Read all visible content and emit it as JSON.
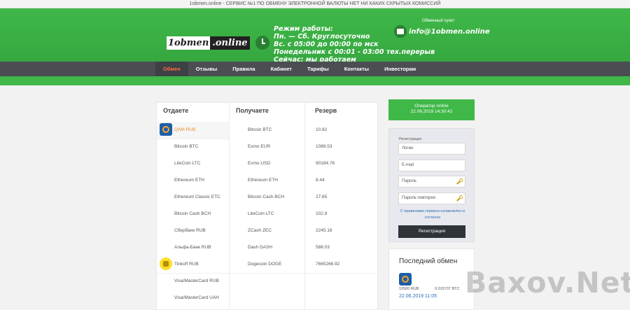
{
  "topbar": {
    "text": "1obmen.online - СЕРВИС №1 ПО ОБМЕНУ ЭЛЕКТРОННОЙ ВАЛЮТЫ НЕТ НИ КАКИХ СКРЫТЫХ КОМИССИЙ"
  },
  "header": {
    "logo_part1": "1obmen",
    "logo_part2": ".online",
    "hours": [
      "Режим работы:",
      "Пн. — Сб.  Круглосуточно",
      "Вс. с 05:00 до 00:00 по мск",
      "Понедельник с 00:01 - 03:00 тех.перерыв",
      "Сейчас: мы работаем"
    ],
    "exchanger_label": "Обменный пункт",
    "email": "info@1obmen.online"
  },
  "nav": {
    "items": [
      {
        "label": "Обмен",
        "active": true
      },
      {
        "label": "Отзывы",
        "active": false
      },
      {
        "label": "Правила",
        "active": false
      },
      {
        "label": "Кабинет",
        "active": false
      },
      {
        "label": "Тарифы",
        "active": false
      },
      {
        "label": "Контакты",
        "active": false
      },
      {
        "label": "Инвесторам",
        "active": false
      }
    ]
  },
  "table": {
    "headers": {
      "give": "Отдаете",
      "receive": "Получаете",
      "reserve": "Резерв"
    },
    "give": [
      {
        "label": "QIWI RUB",
        "icon": "qiwi-icon",
        "selected": true
      },
      {
        "label": "Bitcoin BTC"
      },
      {
        "label": "LiteCoin LTC"
      },
      {
        "label": "Ethereum ETH"
      },
      {
        "label": "Ethereum Classic ETC"
      },
      {
        "label": "Bitcoin Cash BCH"
      },
      {
        "label": "Сбербанк RUB"
      },
      {
        "label": "Альфа-Банк RUB"
      },
      {
        "label": "Tinkoff RUB",
        "icon": "tinkoff-icon"
      },
      {
        "label": "Visa/MasterCard RUB"
      },
      {
        "label": "Visa/MasterCard UAH"
      }
    ],
    "receive": [
      {
        "label": "Bitcoin BTC",
        "reserve": "10.82"
      },
      {
        "label": "Exmo EUR",
        "reserve": "1089.53"
      },
      {
        "label": "Exmo USD",
        "reserve": "90184.76"
      },
      {
        "label": "Ethereum ETH",
        "reserve": "8.44"
      },
      {
        "label": "Bitcoin Cash BCH",
        "reserve": "27.65"
      },
      {
        "label": "LiteCoin LTC",
        "reserve": "102.9"
      },
      {
        "label": "ZCash ZEC",
        "reserve": "2245.16"
      },
      {
        "label": "Dash DASH",
        "reserve": "588.03"
      },
      {
        "label": "Dogecoin DOGE",
        "reserve": "7665266.92"
      }
    ]
  },
  "operator": {
    "status": "Оператор online",
    "datetime": "22.06.2019 14:30:42"
  },
  "registration": {
    "title": "Регистрация",
    "login_placeholder": "Логин",
    "email_placeholder": "E-mail",
    "password_placeholder": "Пароль",
    "password_repeat_placeholder": "Пароль повторно",
    "agree_text": "С правилами сервиса ознакомлен и согласен",
    "button_label": "Регистрация"
  },
  "last_exchange": {
    "title": "Последний обмен",
    "from": "10500 RUB",
    "to": "0.015737 BTC",
    "date": "22.06.2019 11:05"
  },
  "watermark": {
    "text": "Baxov.Net"
  },
  "colors": {
    "brand_green": "#3fb848",
    "nav_dark": "#4a4e52",
    "active_orange": "#ff6a3d"
  }
}
